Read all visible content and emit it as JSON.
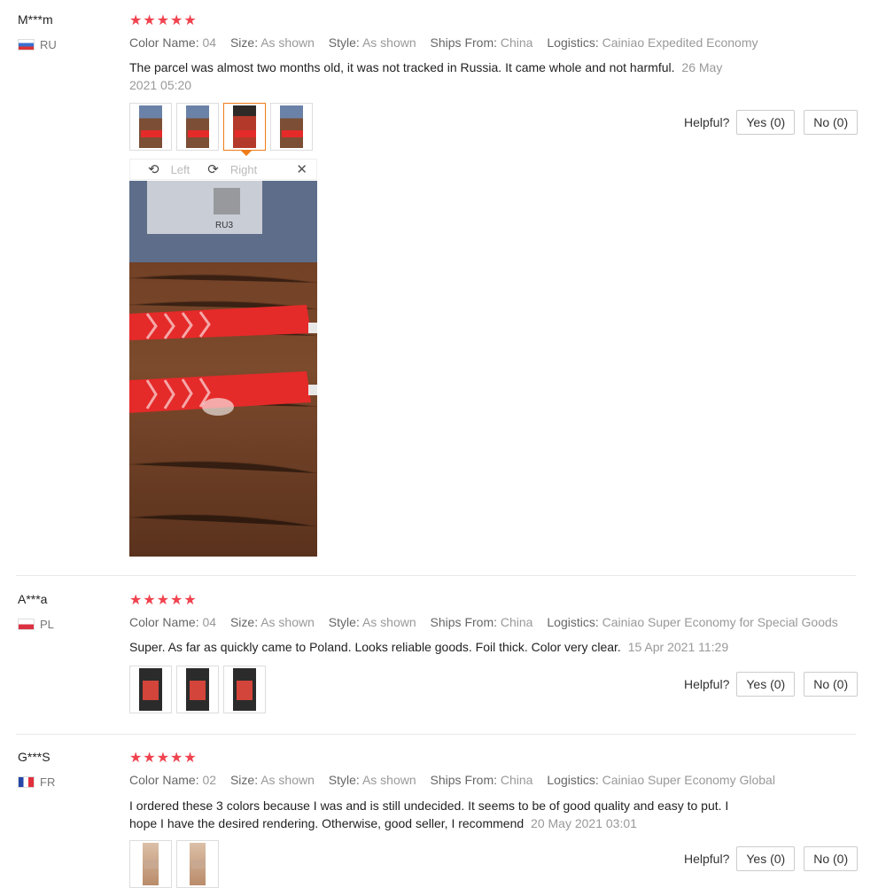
{
  "reviews": [
    {
      "user": "M***m",
      "country": "RU",
      "stars": "★★★★★",
      "color_label": "Color Name:",
      "color_value": "04",
      "size_label": "Size:",
      "size_value": "As shown",
      "style_label": "Style:",
      "style_value": "As shown",
      "ships_label": "Ships From:",
      "ships_value": "China",
      "logistics_label": "Logistics:",
      "logistics_value": "Cainiao Expedited Economy",
      "text": "The parcel was almost two months old, it was not tracked in Russia. It came whole and not harmful.",
      "date": "26 May 2021 05:20",
      "helpful_label": "Helpful?",
      "yes_label": "Yes (0)",
      "no_label": "No (0)"
    },
    {
      "user": "A***a",
      "country": "PL",
      "stars": "★★★★★",
      "color_label": "Color Name:",
      "color_value": "04",
      "size_label": "Size:",
      "size_value": "As shown",
      "style_label": "Style:",
      "style_value": "As shown",
      "ships_label": "Ships From:",
      "ships_value": "China",
      "logistics_label": "Logistics:",
      "logistics_value": "Cainiao Super Economy for Special Goods",
      "text": "Super. As far as quickly came to Poland. Looks reliable goods. Foil thick. Color very clear.",
      "date": "15 Apr 2021 11:29",
      "helpful_label": "Helpful?",
      "yes_label": "Yes (0)",
      "no_label": "No (0)"
    },
    {
      "user": "G***S",
      "country": "FR",
      "stars": "★★★★★",
      "color_label": "Color Name:",
      "color_value": "02",
      "size_label": "Size:",
      "size_value": "As shown",
      "style_label": "Style:",
      "style_value": "As shown",
      "ships_label": "Ships From:",
      "ships_value": "China",
      "logistics_label": "Logistics:",
      "logistics_value": "Cainiao Super Economy Global",
      "text": "I ordered these 3 colors because I was and is still undecided. It seems to be of good quality and easy to put. I hope I have the desired rendering. Otherwise, good seller, I recommend",
      "date": "20 May 2021 03:01",
      "helpful_label": "Helpful?",
      "yes_label": "Yes (0)",
      "no_label": "No (0)"
    }
  ],
  "viewer": {
    "left_label": "Left",
    "right_label": "Right",
    "photo_label": "RU3",
    "rotate_left_icon": "rotate-left-icon",
    "rotate_right_icon": "rotate-right-icon",
    "close_icon": "close-icon"
  },
  "colors": {
    "star": "#f0434f",
    "active_thumb": "#f07c18",
    "sticker_red": "#e52a2a"
  }
}
